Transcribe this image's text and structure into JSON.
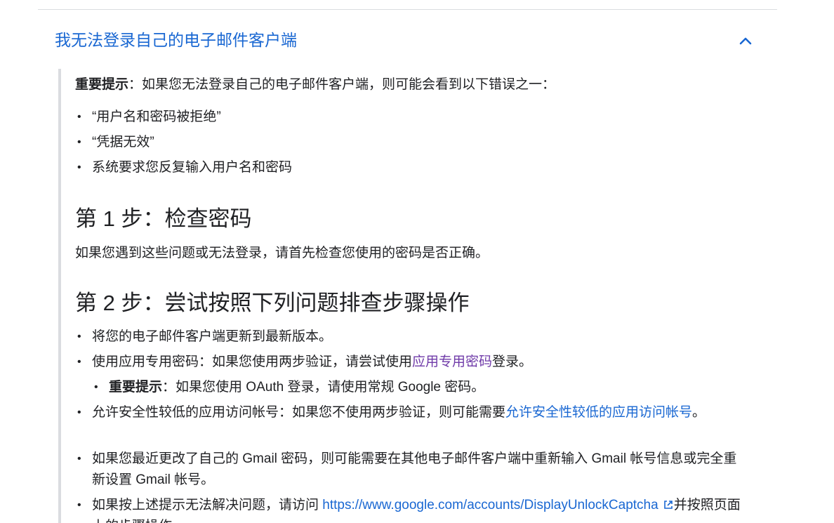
{
  "accordion": {
    "title": "我无法登录自己的电子邮件客户端",
    "expanded": true
  },
  "intro": {
    "label": "重要提示",
    "text": "：如果您无法登录自己的电子邮件客户端，则可能会看到以下错误之一："
  },
  "errors": [
    "“用户名和密码被拒绝”",
    "“凭据无效”",
    "系统要求您反复输入用户名和密码"
  ],
  "step1": {
    "title": "第 1 步：检查密码",
    "text": "如果您遇到这些问题或无法登录，请首先检查您使用的密码是否正确。"
  },
  "step2": {
    "title": "第 2 步：尝试按照下列问题排查步骤操作",
    "item1": "将您的电子邮件客户端更新到最新版本。",
    "item2": {
      "before": "使用应用专用密码：如果您使用两步验证，请尝试使用",
      "link": "应用专用密码",
      "after": "登录。"
    },
    "sub": {
      "label": "重要提示",
      "text": "：如果您使用 OAuth 登录，请使用常规 Google 密码。"
    },
    "item3": {
      "before": "允许安全性较低的应用访问帐号：如果您不使用两步验证，则可能需要",
      "link": "允许安全性较低的应用访问帐号",
      "after": "。"
    },
    "item4": "如果您最近更改了自己的 Gmail 密码，则可能需要在其他电子邮件客户端中重新输入 Gmail 帐号信息或完全重新设置 Gmail 帐号。",
    "item5": {
      "before": "如果按上述提示无法解决问题，请访问 ",
      "link": "https://www.google.com/accounts/DisplayUnlockCaptcha",
      "after": "并按照页面上的步骤操作。"
    }
  },
  "colors": {
    "link": "#1967d2",
    "visited_link": "#6f3aa8",
    "border": "#dadce0",
    "text": "#202124"
  }
}
